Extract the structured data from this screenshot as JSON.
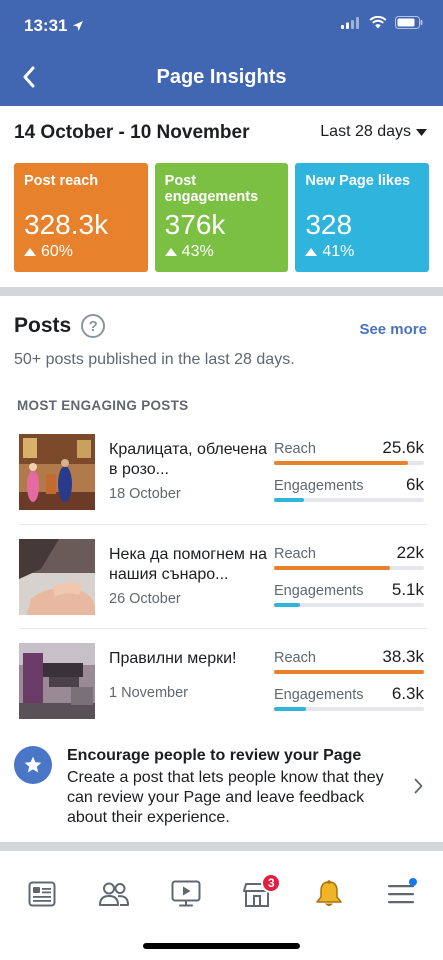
{
  "status_bar": {
    "time": "13:31"
  },
  "header": {
    "title": "Page Insights"
  },
  "range": {
    "label": "14 October - 10 November",
    "period": "Last 28 days"
  },
  "cards": [
    {
      "label": "Post reach",
      "value": "328.3k",
      "delta": "60%",
      "color": "#e7812c"
    },
    {
      "label": "Post engagements",
      "value": "376k",
      "delta": "43%",
      "color": "#7bc043"
    },
    {
      "label": "New Page likes",
      "value": "328",
      "delta": "41%",
      "color": "#2fb5dd"
    }
  ],
  "posts": {
    "title": "Posts",
    "see_more": "See more",
    "subtitle": "50+ posts published in the last 28 days.",
    "section_heading": "MOST ENGAGING POSTS",
    "metric_labels": {
      "reach": "Reach",
      "engagements": "Engagements"
    },
    "items": [
      {
        "title": "Кралицата, облечена в розо...",
        "date": "18 October",
        "reach": "25.6k",
        "engagements": "6k",
        "reach_fraction": 0.89,
        "engagements_fraction": 0.2
      },
      {
        "title": "Нека да помогнем на нашия сънаро...",
        "date": "26 October",
        "reach": "22k",
        "engagements": "5.1k",
        "reach_fraction": 0.77,
        "engagements_fraction": 0.17
      },
      {
        "title": "Правилни мерки!",
        "date": "1 November",
        "reach": "38.3k",
        "engagements": "6.3k",
        "reach_fraction": 1.0,
        "engagements_fraction": 0.21
      }
    ]
  },
  "encourage": {
    "title": "Encourage people to review your Page",
    "body": "Create a post that lets people know that they can review your Page and leave feedback about their experience."
  },
  "tabbar": {
    "marketplace_badge": "3"
  },
  "colors": {
    "brand": "#4267b2",
    "reach_bar": "#e7812c",
    "engagement_bar": "#2fb5dd"
  }
}
